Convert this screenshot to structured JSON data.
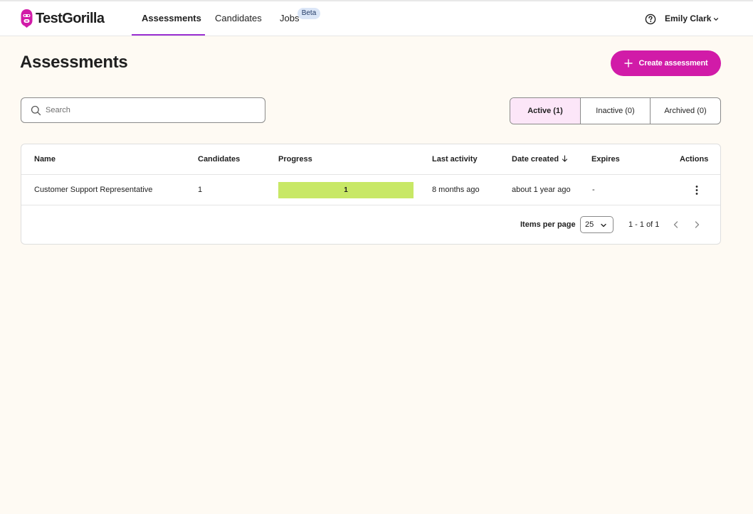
{
  "app": {
    "brand": "TestGorilla",
    "brand_color": "#d11ba8",
    "accent_underline": "#9b2fd1"
  },
  "nav": {
    "items": [
      {
        "label": "Assessments",
        "active": true
      },
      {
        "label": "Candidates",
        "active": false
      },
      {
        "label": "Jobs",
        "active": false,
        "badge": "Beta"
      }
    ]
  },
  "user": {
    "name": "Emily Clark",
    "help_icon": "question-circle-icon",
    "menu_icon": "chevron-down-icon"
  },
  "page": {
    "title": "Assessments",
    "create_button": "Create assessment"
  },
  "search": {
    "placeholder": "Search",
    "value": ""
  },
  "status_tabs": [
    {
      "label": "Active (1)",
      "active": true
    },
    {
      "label": "Inactive (0)",
      "active": false
    },
    {
      "label": "Archived (0)",
      "active": false
    }
  ],
  "table": {
    "columns": [
      "Name",
      "Candidates",
      "Progress",
      "Last activity",
      "Date created",
      "Expires",
      "Actions"
    ],
    "sorted_column": "Date created",
    "sort_direction": "descending",
    "rows": [
      {
        "name": "Customer Support Representative",
        "candidates": "1",
        "progress_label": "1",
        "progress_fraction": 1.0,
        "progress_color": "#c8e866",
        "last_activity": "8 months ago",
        "date_created": "about 1 year ago",
        "expires": "-"
      }
    ]
  },
  "pagination": {
    "items_per_page_label": "Items per page",
    "items_per_page": "25",
    "range": "1 - 1 of 1"
  }
}
